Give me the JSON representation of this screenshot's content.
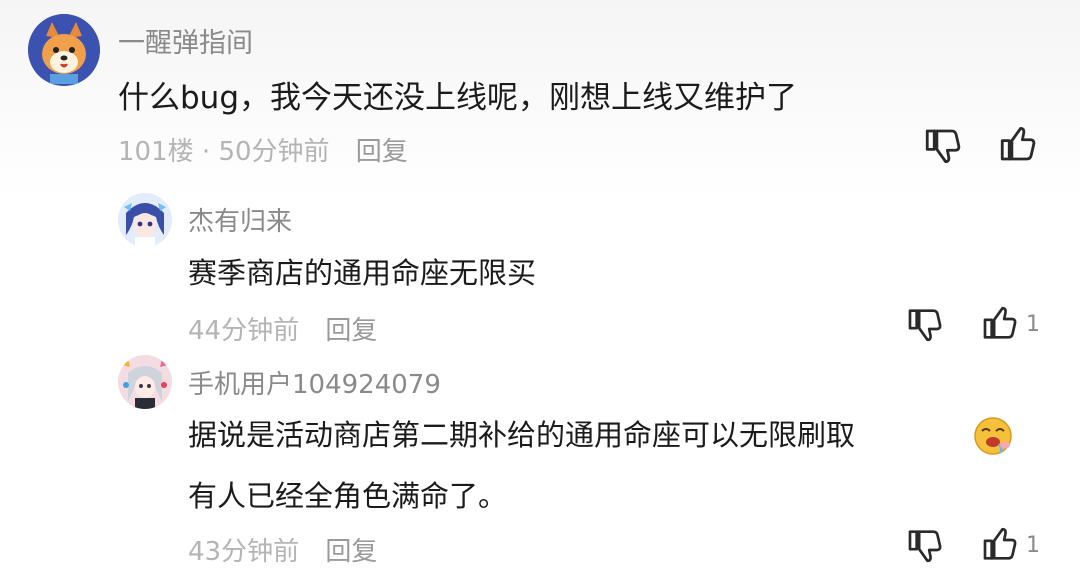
{
  "comments": [
    {
      "username": "一醒弹指间",
      "text": "什么bug，我今天还没上线呢，刚想上线又维护了",
      "floor": "101楼",
      "separator": "·",
      "time": "50分钟前",
      "reply_label": "回复",
      "like_count": ""
    },
    {
      "username": "杰有归来",
      "text": "赛季商店的通用命座无限买",
      "time": "44分钟前",
      "reply_label": "回复",
      "like_count": "1"
    },
    {
      "username": "手机用户104924079",
      "text_line1": "据说是活动商店第二期补给的通用命座可以无限刷取",
      "text_line2": "有人已经全角色满命了。",
      "time": "43分钟前",
      "reply_label": "回复",
      "like_count": "1"
    }
  ]
}
